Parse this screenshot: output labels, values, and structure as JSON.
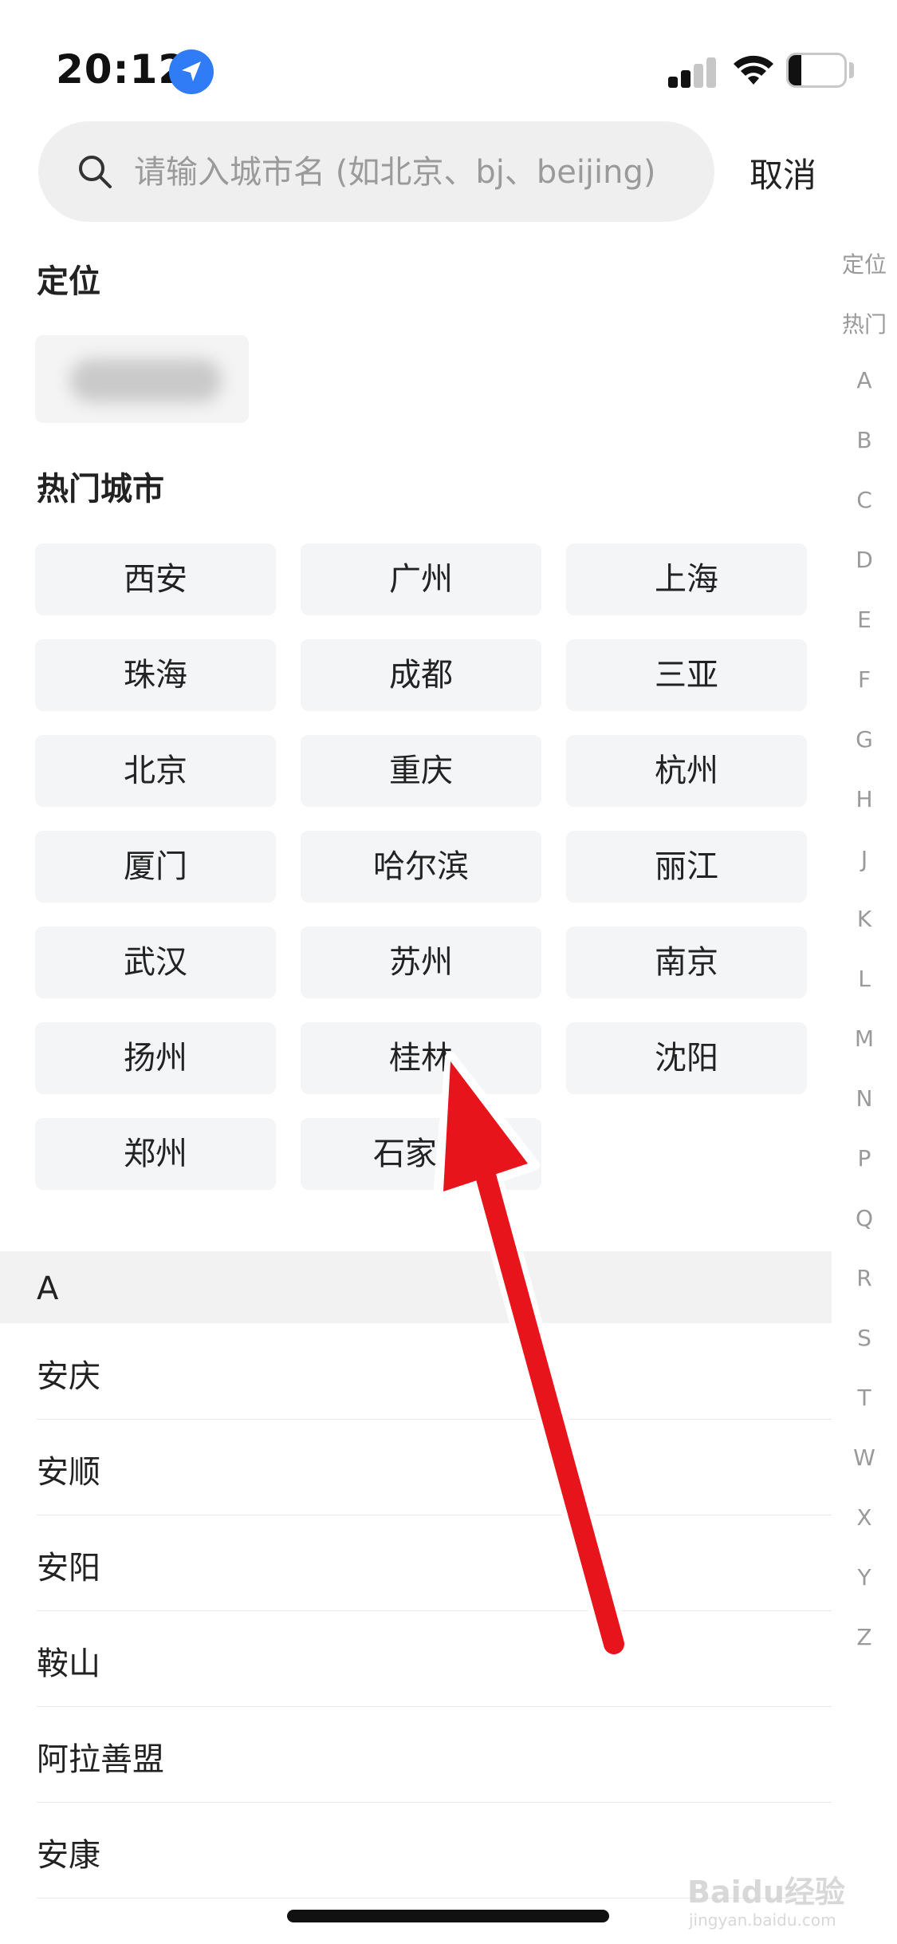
{
  "status_bar": {
    "time": "20:12",
    "battery": "23",
    "battery_level_percent": 23,
    "signal_bars_active": 2,
    "location_icon": "location-arrow-icon",
    "wifi_icon": "wifi-icon"
  },
  "search": {
    "placeholder": "请输入城市名 (如北京、bj、beijing)",
    "value": "",
    "cancel_label": "取消",
    "icon": "search-icon"
  },
  "location_section": {
    "title": "定位",
    "current_city_obscured": true
  },
  "hot_section": {
    "title": "热门城市",
    "cities": [
      "西安",
      "广州",
      "上海",
      "珠海",
      "成都",
      "三亚",
      "北京",
      "重庆",
      "杭州",
      "厦门",
      "哈尔滨",
      "丽江",
      "武汉",
      "苏州",
      "南京",
      "扬州",
      "桂林",
      "沈阳",
      "郑州",
      "石家庄"
    ]
  },
  "city_list": {
    "header": "A",
    "items": [
      "安庆",
      "安顺",
      "安阳",
      "鞍山",
      "阿拉善盟",
      "安康"
    ]
  },
  "index_bar": [
    "定位",
    "热门",
    "A",
    "B",
    "C",
    "D",
    "E",
    "F",
    "G",
    "H",
    "J",
    "K",
    "L",
    "M",
    "N",
    "P",
    "Q",
    "R",
    "S",
    "T",
    "W",
    "X",
    "Y",
    "Z"
  ],
  "overlay": {
    "arrow_color": "#e8141c",
    "watermark": "Baidu经验",
    "watermark_sub": "jingyan.baidu.com"
  }
}
